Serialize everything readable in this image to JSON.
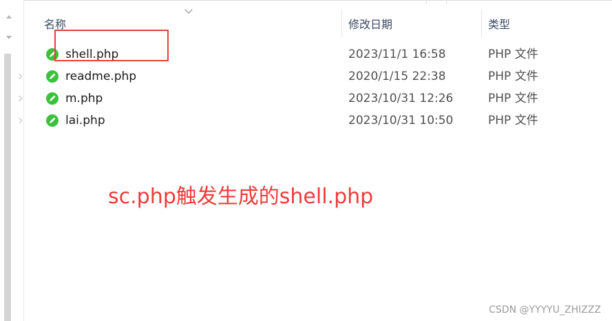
{
  "columns": {
    "name": "名称",
    "date_modified": "修改日期",
    "type": "类型"
  },
  "files": [
    {
      "name": "shell.php",
      "date": "2023/11/1 16:58",
      "type": "PHP 文件",
      "icon": "php-file-icon"
    },
    {
      "name": "readme.php",
      "date": "2020/1/15 22:38",
      "type": "PHP 文件",
      "icon": "php-file-icon"
    },
    {
      "name": "m.php",
      "date": "2023/10/31 12:26",
      "type": "PHP 文件",
      "icon": "php-file-icon"
    },
    {
      "name": "lai.php",
      "date": "2023/10/31 10:50",
      "type": "PHP 文件",
      "icon": "php-file-icon"
    }
  ],
  "annotation": {
    "caption": "sc.php触发生成的shell.php",
    "highlight_color": "#e04040",
    "caption_color": "#ef3b3b"
  },
  "watermark": "CSDN @YYYYU_ZHIZZZ",
  "colors": {
    "icon_green": "#3cc13c",
    "header_text": "#3a4a66"
  }
}
